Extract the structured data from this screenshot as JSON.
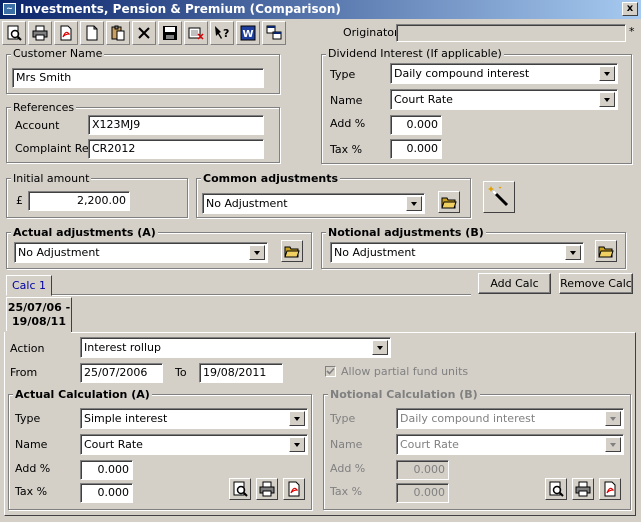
{
  "window": {
    "title": "Investments, Pension & Premium (Comparison)",
    "close_glyph": "x"
  },
  "toolbar": {
    "buttons": [
      "print-preview-icon",
      "print-icon",
      "pdf-icon",
      "new-document-icon",
      "paste-icon",
      "delete-icon",
      "save-icon",
      "clear-icon",
      "help-icon",
      "word-icon",
      "copy-window-icon"
    ],
    "originator_label": "Originator",
    "originator_value": "",
    "required_mark": "*"
  },
  "customer": {
    "group_label": "Customer Name",
    "name": "Mrs Smith"
  },
  "references": {
    "group_label": "References",
    "account_label": "Account",
    "account": "X123MJ9",
    "complaint_label": "Complaint Ref.",
    "complaint": "CR2012"
  },
  "dividend": {
    "group_label": "Dividend Interest (If applicable)",
    "type_label": "Type",
    "type": "Daily compound interest",
    "name_label": "Name",
    "name": "Court Rate",
    "add_label": "Add %",
    "add": "0.000",
    "tax_label": "Tax %",
    "tax": "0.000"
  },
  "initial": {
    "group_label": "Initial amount",
    "currency": "£",
    "amount": "2,200.00"
  },
  "common": {
    "group_label": "Common adjustments",
    "value": "No Adjustment"
  },
  "actual_adj": {
    "group_label": "Actual adjustments (A)",
    "value": "No Adjustment"
  },
  "notional_adj": {
    "group_label": "Notional adjustments (B)",
    "value": "No Adjustment"
  },
  "tabs": {
    "calc1": "Calc 1",
    "add_calc": "Add Calc",
    "remove_calc": "Remove Calc"
  },
  "period": {
    "line1": "25/07/06 -",
    "line2": "19/08/11"
  },
  "calc": {
    "action_label": "Action",
    "action": "Interest rollup",
    "from_label": "From",
    "from": "25/07/2006",
    "to_label": "To",
    "to": "19/08/2011",
    "allow_partial": "Allow partial fund units",
    "actual": {
      "group_label": "Actual Calculation (A)",
      "type_label": "Type",
      "type": "Simple interest",
      "name_label": "Name",
      "name": "Court Rate",
      "add_label": "Add %",
      "add": "0.000",
      "tax_label": "Tax %",
      "tax": "0.000"
    },
    "notional": {
      "group_label": "Notional Calculation (B)",
      "type_label": "Type",
      "type": "Daily compound interest",
      "name_label": "Name",
      "name": "Court Rate",
      "add_label": "Add %",
      "add": "0.000",
      "tax_label": "Tax %",
      "tax": "0.000"
    }
  }
}
